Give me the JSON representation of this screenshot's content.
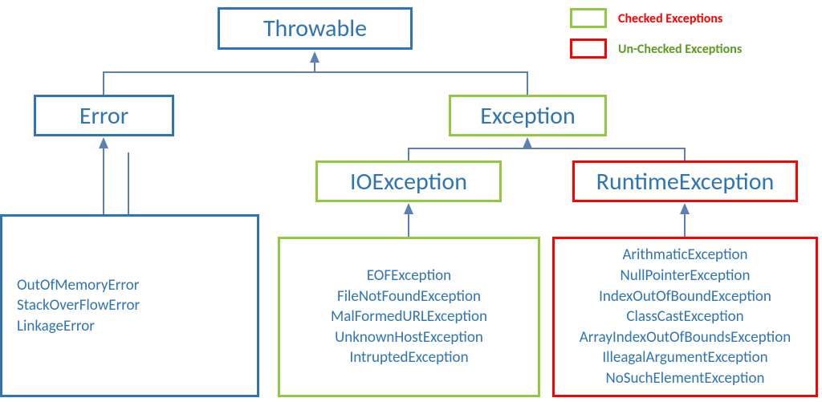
{
  "chart_data": {
    "type": "tree",
    "title": "Java Throwable hierarchy",
    "nodes": {
      "throwable": {
        "name": "Throwable",
        "kind": "base"
      },
      "error": {
        "name": "Error",
        "kind": "unchecked",
        "examples": [
          "OutOfMemoryError",
          "StackOverFlowError",
          "LinkageError"
        ]
      },
      "exception": {
        "name": "Exception",
        "kind": "checked"
      },
      "ioexception": {
        "name": "IOException",
        "kind": "checked",
        "examples": [
          "EOFException",
          "FileNotFoundException",
          "MalFormedURLException",
          "UnknownHostException",
          "IntruptedException"
        ]
      },
      "runtimeexception": {
        "name": "RuntimeException",
        "kind": "unchecked",
        "examples": [
          "ArithmaticException",
          "NullPointerException",
          "IndexOutOfBoundException",
          "ClassCastException",
          "ArrayIndexOutOfBoundsException",
          "IlleagalArgumentException",
          "NoSuchElementException"
        ]
      }
    },
    "edges": [
      [
        "error",
        "throwable"
      ],
      [
        "exception",
        "throwable"
      ],
      [
        "ioexception",
        "exception"
      ],
      [
        "runtimeexception",
        "exception"
      ]
    ],
    "legend": [
      {
        "swatch": "green",
        "label": "Checked Exceptions"
      },
      {
        "swatch": "red",
        "label": "Un-Checked Exceptions"
      }
    ]
  },
  "colors": {
    "text": "#2f74b5",
    "green": "#92c841",
    "red": "#ff0000",
    "blue": "#2f74b5",
    "connector": "#5c7fb4"
  },
  "labels": {
    "throwable": "Throwable",
    "error": "Error",
    "exception": "Exception",
    "ioexception": "IOException",
    "runtimeexception": "RuntimeException",
    "legend_checked": "Checked Exceptions",
    "legend_unchecked": "Un-Checked Exceptions"
  },
  "lists": {
    "error": [
      "OutOfMemoryError",
      "StackOverFlowError",
      "LinkageError"
    ],
    "io": [
      "EOFException",
      "FileNotFoundException",
      "MalFormedURLException",
      "UnknownHostException",
      "IntruptedException"
    ],
    "runtime": [
      "ArithmaticException",
      "NullPointerException",
      "IndexOutOfBoundException",
      "ClassCastException",
      "ArrayIndexOutOfBoundsException",
      "IlleagalArgumentException",
      "NoSuchElementException"
    ]
  }
}
